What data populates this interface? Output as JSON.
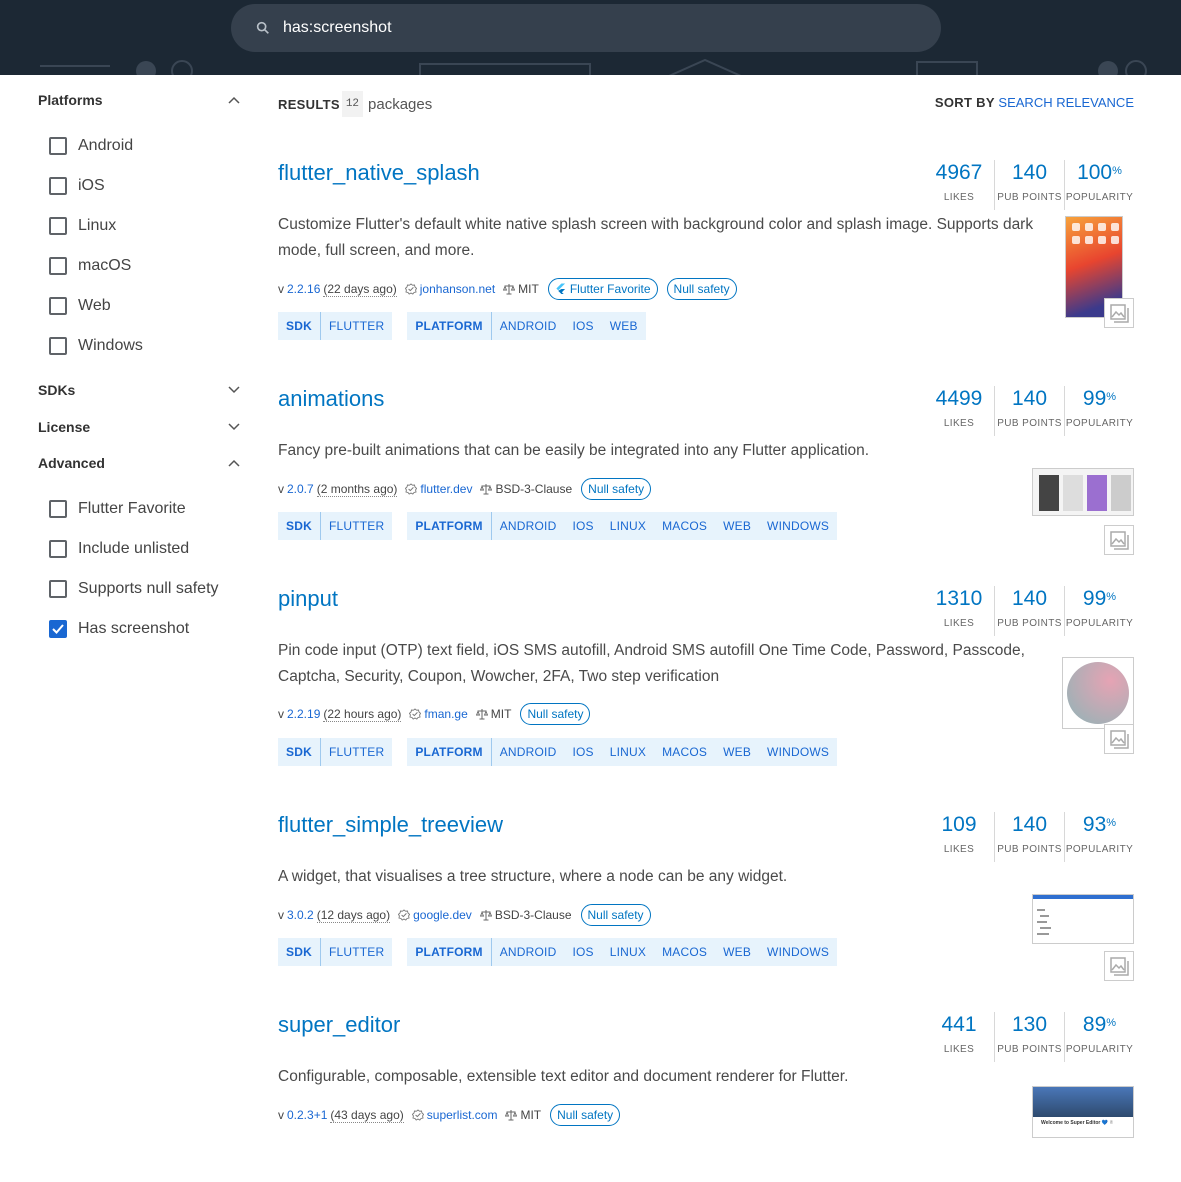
{
  "search": {
    "value": "has:screenshot"
  },
  "sidebar": {
    "platforms": {
      "title": "Platforms",
      "items": [
        {
          "label": "Android",
          "checked": false
        },
        {
          "label": "iOS",
          "checked": false
        },
        {
          "label": "Linux",
          "checked": false
        },
        {
          "label": "macOS",
          "checked": false
        },
        {
          "label": "Web",
          "checked": false
        },
        {
          "label": "Windows",
          "checked": false
        }
      ]
    },
    "sdks": {
      "title": "SDKs"
    },
    "license": {
      "title": "License"
    },
    "advanced": {
      "title": "Advanced",
      "items": [
        {
          "label": "Flutter Favorite",
          "checked": false
        },
        {
          "label": "Include unlisted",
          "checked": false
        },
        {
          "label": "Supports null safety",
          "checked": false
        },
        {
          "label": "Has screenshot",
          "checked": true
        }
      ]
    }
  },
  "results": {
    "label": "RESULTS",
    "count": "12",
    "unit": "packages"
  },
  "sort": {
    "label": "SORT BY",
    "value": "SEARCH RELEVANCE"
  },
  "stat_labels": {
    "likes": "LIKES",
    "points": "PUB POINTS",
    "popularity": "POPULARITY"
  },
  "tag_labels": {
    "sdk": "SDK",
    "platform": "PLATFORM"
  },
  "packages": [
    {
      "name": "flutter_native_splash",
      "description": "Customize Flutter's default white native splash screen with background color and splash image. Supports dark mode, full screen, and more.",
      "version_prefix": "v",
      "version": "2.2.16",
      "ago": "(22 days ago)",
      "publisher": "jonhanson.net",
      "license": "MIT",
      "flutter_favorite": "Flutter Favorite",
      "null_safety": "Null safety",
      "likes": "4967",
      "points": "140",
      "popularity": "100",
      "sdks": [
        "FLUTTER"
      ],
      "platforms": [
        "ANDROID",
        "IOS",
        "WEB"
      ]
    },
    {
      "name": "animations",
      "description": "Fancy pre-built animations that can be easily be integrated into any Flutter application.",
      "version_prefix": "v",
      "version": "2.0.7",
      "ago": "(2 months ago)",
      "publisher": "flutter.dev",
      "license": "BSD-3-Clause",
      "null_safety": "Null safety",
      "likes": "4499",
      "points": "140",
      "popularity": "99",
      "sdks": [
        "FLUTTER"
      ],
      "platforms": [
        "ANDROID",
        "IOS",
        "LINUX",
        "MACOS",
        "WEB",
        "WINDOWS"
      ]
    },
    {
      "name": "pinput",
      "description": "Pin code input (OTP) text field, iOS SMS autofill, Android SMS autofill One Time Code, Password, Passcode, Captcha, Security, Coupon, Wowcher, 2FA, Two step verification",
      "version_prefix": "v",
      "version": "2.2.19",
      "ago": "(22 hours ago)",
      "publisher": "fman.ge",
      "license": "MIT",
      "null_safety": "Null safety",
      "likes": "1310",
      "points": "140",
      "popularity": "99",
      "sdks": [
        "FLUTTER"
      ],
      "platforms": [
        "ANDROID",
        "IOS",
        "LINUX",
        "MACOS",
        "WEB",
        "WINDOWS"
      ]
    },
    {
      "name": "flutter_simple_treeview",
      "description": "A widget, that visualises a tree structure, where a node can be any widget.",
      "version_prefix": "v",
      "version": "3.0.2",
      "ago": "(12 days ago)",
      "publisher": "google.dev",
      "license": "BSD-3-Clause",
      "null_safety": "Null safety",
      "likes": "109",
      "points": "140",
      "popularity": "93",
      "sdks": [
        "FLUTTER"
      ],
      "platforms": [
        "ANDROID",
        "IOS",
        "LINUX",
        "MACOS",
        "WEB",
        "WINDOWS"
      ]
    },
    {
      "name": "super_editor",
      "description": "Configurable, composable, extensible text editor and document renderer for Flutter.",
      "version_prefix": "v",
      "version": "0.2.3+1",
      "ago": "(43 days ago)",
      "publisher": "superlist.com",
      "license": "MIT",
      "null_safety": "Null safety",
      "likes": "441",
      "points": "130",
      "popularity": "89"
    }
  ],
  "thumb_text": "Welcome to Super Editor 💙 ✌",
  "colors": {
    "header_bg": "#1c2834",
    "link": "#0175c2",
    "tag_bg": "#e7f3fc",
    "checkbox_checked": "#1967d2"
  }
}
